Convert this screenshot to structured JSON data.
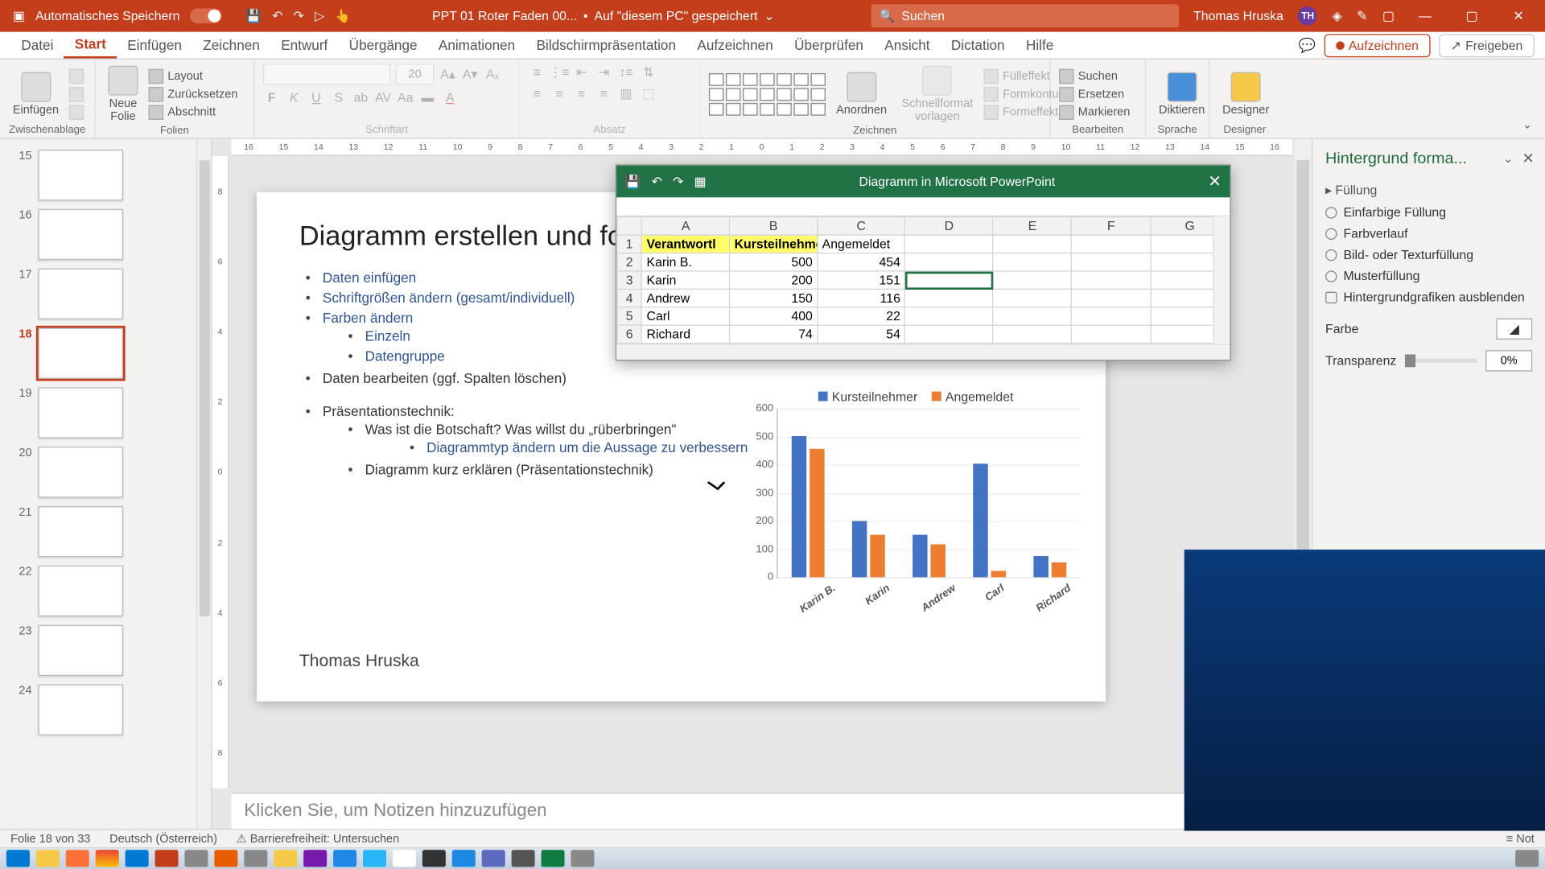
{
  "titlebar": {
    "autosave": "Automatisches Speichern",
    "filename": "PPT 01 Roter Faden 00...",
    "saved": "Auf \"diesem PC\" gespeichert",
    "search_placeholder": "Suchen",
    "user": "Thomas Hruska",
    "initials": "TH"
  },
  "tabs": {
    "items": [
      "Datei",
      "Start",
      "Einfügen",
      "Zeichnen",
      "Entwurf",
      "Übergänge",
      "Animationen",
      "Bildschirmpräsentation",
      "Aufzeichnen",
      "Überprüfen",
      "Ansicht",
      "Dictation",
      "Hilfe"
    ],
    "active": "Start",
    "record": "Aufzeichnen",
    "share": "Freigeben"
  },
  "ribbon": {
    "clipboard": {
      "label": "Zwischenablage",
      "paste": "Einfügen"
    },
    "slides": {
      "label": "Folien",
      "new": "Neue\nFolie",
      "layout": "Layout",
      "reset": "Zurücksetzen",
      "section": "Abschnitt"
    },
    "font": {
      "label": "Schriftart",
      "size": "20"
    },
    "para": {
      "label": "Absatz"
    },
    "drawing": {
      "label": "Zeichnen",
      "arrange": "Anordnen",
      "quick": "Schnellformat\nvorlagen",
      "fill": "Fülleffekt",
      "outline": "Formkontur",
      "effects": "Formeffekte"
    },
    "editing": {
      "label": "Bearbeiten",
      "find": "Suchen",
      "replace": "Ersetzen",
      "select": "Markieren"
    },
    "voice": {
      "label": "Sprache",
      "dictate": "Diktieren"
    },
    "designer": {
      "label": "Designer",
      "btn": "Designer"
    }
  },
  "ruler_h": [
    "16",
    "15",
    "14",
    "13",
    "12",
    "11",
    "10",
    "9",
    "8",
    "7",
    "6",
    "5",
    "4",
    "3",
    "2",
    "1",
    "0",
    "1",
    "2",
    "3",
    "4",
    "5",
    "6",
    "7",
    "8",
    "9",
    "10",
    "11",
    "12",
    "13",
    "14",
    "15",
    "16"
  ],
  "ruler_v": [
    "8",
    "6",
    "4",
    "2",
    "0",
    "2",
    "4",
    "6",
    "8"
  ],
  "thumbs": [
    15,
    16,
    17,
    18,
    19,
    20,
    21,
    22,
    23,
    24
  ],
  "thumb_active": 18,
  "slide": {
    "title": "Diagramm erstellen und formatieren",
    "b1": "Daten einfügen",
    "b2": "Schriftgrößen ändern (gesamt/individuell)",
    "b3": "Farben ändern",
    "b3a": "Einzeln",
    "b3b": "Datengruppe",
    "b4": "Daten bearbeiten (ggf. Spalten löschen)",
    "b5": "Präsentationstechnik:",
    "b5a": "Was ist die Botschaft? Was willst du „rüberbringen\"",
    "b5a1": "Diagrammtyp ändern um die Aussage zu verbessern",
    "b5b": "Diagramm kurz erklären (Präsentationstechnik)",
    "author": "Thomas Hruska"
  },
  "editor": {
    "title": "Diagramm in Microsoft PowerPoint",
    "cols": [
      "",
      "A",
      "B",
      "C",
      "D",
      "E",
      "F",
      "G"
    ],
    "h1": "Verantwortl",
    "h2": "Kursteilnehme",
    "h3": "Angemeldet",
    "rows": [
      {
        "n": "2",
        "a": "Karin B.",
        "b": "500",
        "c": "454"
      },
      {
        "n": "3",
        "a": "Karin",
        "b": "200",
        "c": "151"
      },
      {
        "n": "4",
        "a": "Andrew",
        "b": "150",
        "c": "116"
      },
      {
        "n": "5",
        "a": "Carl",
        "b": "400",
        "c": "22"
      },
      {
        "n": "6",
        "a": "Richard",
        "b": "74",
        "c": "54"
      }
    ]
  },
  "chart_data": {
    "type": "bar",
    "categories": [
      "Karin B.",
      "Karin",
      "Andrew",
      "Carl",
      "Richard"
    ],
    "series": [
      {
        "name": "Kursteilnehmer",
        "values": [
          500,
          200,
          150,
          400,
          74
        ]
      },
      {
        "name": "Angemeldet",
        "values": [
          454,
          151,
          116,
          22,
          54
        ]
      }
    ],
    "ylim": [
      0,
      600
    ],
    "yticks": [
      0,
      100,
      200,
      300,
      400,
      500,
      600
    ],
    "title": "",
    "xlabel": "",
    "ylabel": ""
  },
  "notes": {
    "placeholder": "Klicken Sie, um Notizen hinzuzufügen"
  },
  "fpane": {
    "title": "Hintergrund forma...",
    "section": "Füllung",
    "o1": "Einfarbige Füllung",
    "o2": "Farbverlauf",
    "o3": "Bild- oder Texturfüllung",
    "o4": "Musterfüllung",
    "o5": "Hintergrundgrafiken ausblenden",
    "color": "Farbe",
    "trans": "Transparenz",
    "pct": "0%"
  },
  "status": {
    "slide": "Folie 18 von 33",
    "lang": "Deutsch (Österreich)",
    "a11y": "Barrierefreiheit: Untersuchen",
    "notes": "Not"
  }
}
